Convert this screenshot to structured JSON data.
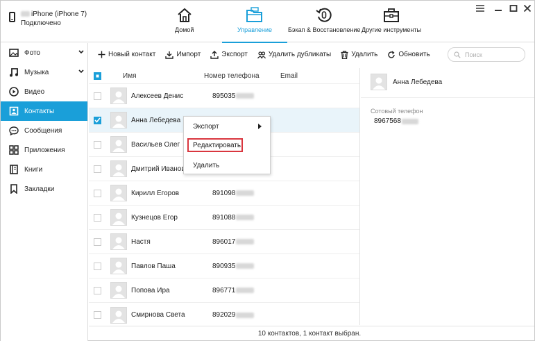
{
  "device": {
    "name": "iPhone (iPhone 7)",
    "status": "Подключено"
  },
  "nav": [
    {
      "label": "Домой",
      "icon": "home-icon"
    },
    {
      "label": "Управление",
      "icon": "folder-icon"
    },
    {
      "label": "Бэкап & Восстановление",
      "icon": "backup-icon"
    },
    {
      "label": "Другие инструменты",
      "icon": "toolbox-icon"
    }
  ],
  "sidebar": {
    "items": [
      {
        "label": "Фото",
        "icon": "photo-icon"
      },
      {
        "label": "Музыка",
        "icon": "music-icon"
      },
      {
        "label": "Видео",
        "icon": "video-icon"
      },
      {
        "label": "Контакты",
        "icon": "contacts-icon"
      },
      {
        "label": "Сообщения",
        "icon": "messages-icon"
      },
      {
        "label": "Приложения",
        "icon": "apps-icon"
      },
      {
        "label": "Книги",
        "icon": "books-icon"
      },
      {
        "label": "Закладки",
        "icon": "bookmark-icon"
      }
    ]
  },
  "toolbar": {
    "new_contact": "Новый контакт",
    "import": "Импорт",
    "export": "Экспорт",
    "dedupe": "Удалить дубликаты",
    "delete": "Удалить",
    "refresh": "Обновить",
    "search_placeholder": "Поиск"
  },
  "table": {
    "headers": {
      "name": "Имя",
      "phone": "Номер телефона",
      "email": "Email"
    },
    "rows": [
      {
        "name": "Алексеев Денис",
        "phone": "895035"
      },
      {
        "name": "Анна Лебедева",
        "phone": ""
      },
      {
        "name": "Васильев Олег",
        "phone": ""
      },
      {
        "name": "Дмитрий Иванов",
        "phone": ""
      },
      {
        "name": "Кирилл Егоров",
        "phone": "891098"
      },
      {
        "name": "Кузнецов Егор",
        "phone": "891088"
      },
      {
        "name": "Настя",
        "phone": "896017"
      },
      {
        "name": "Павлов Паша",
        "phone": "890935"
      },
      {
        "name": "Попова Ира",
        "phone": "896771"
      },
      {
        "name": "Смирнова Света",
        "phone": "892029"
      }
    ]
  },
  "context_menu": {
    "export": "Экспорт",
    "edit": "Редактировать",
    "delete": "Удалить"
  },
  "detail": {
    "name": "Анна Лебедева",
    "phone_label": "Сотовый телефон",
    "phone_value": "8967568"
  },
  "status": "10 контактов, 1 контакт выбран.",
  "colors": {
    "accent": "#1a9fd9",
    "highlight": "#d9363e",
    "selected_row": "#e9f4fa"
  }
}
